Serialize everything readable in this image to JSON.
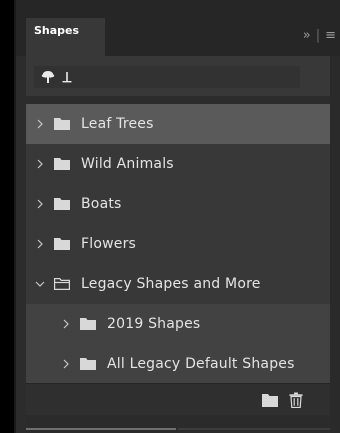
{
  "panel": {
    "tab_label": "Shapes",
    "menu_expand_glyph": "»",
    "menu_separator": "|",
    "menu_glyph": "≡"
  },
  "toolbar": {
    "tools": [
      {
        "icon": "tree-shape-icon"
      },
      {
        "icon": "anchor-down-icon"
      }
    ]
  },
  "list": {
    "items": [
      {
        "label": "Leaf Trees",
        "expanded": false,
        "selected": true,
        "level": 0
      },
      {
        "label": "Wild Animals",
        "expanded": false,
        "selected": false,
        "level": 0
      },
      {
        "label": "Boats",
        "expanded": false,
        "selected": false,
        "level": 0
      },
      {
        "label": "Flowers",
        "expanded": false,
        "selected": false,
        "level": 0
      },
      {
        "label": "Legacy Shapes and More",
        "expanded": true,
        "selected": false,
        "level": 0
      },
      {
        "label": "2019 Shapes",
        "expanded": false,
        "selected": false,
        "level": 1
      },
      {
        "label": "All Legacy Default Shapes",
        "expanded": false,
        "selected": false,
        "level": 1
      }
    ]
  },
  "bottom_bar": {
    "buttons": [
      {
        "icon": "new-group-folder-icon"
      },
      {
        "icon": "trash-icon"
      }
    ]
  },
  "colors": {
    "panel_bg": "#2c2c2c",
    "row_bg": "#383838",
    "selected_row_bg": "#5a5a5a",
    "child_row_bg": "#424242",
    "text": "#e4e4e4",
    "icon": "#d8d8d8"
  }
}
